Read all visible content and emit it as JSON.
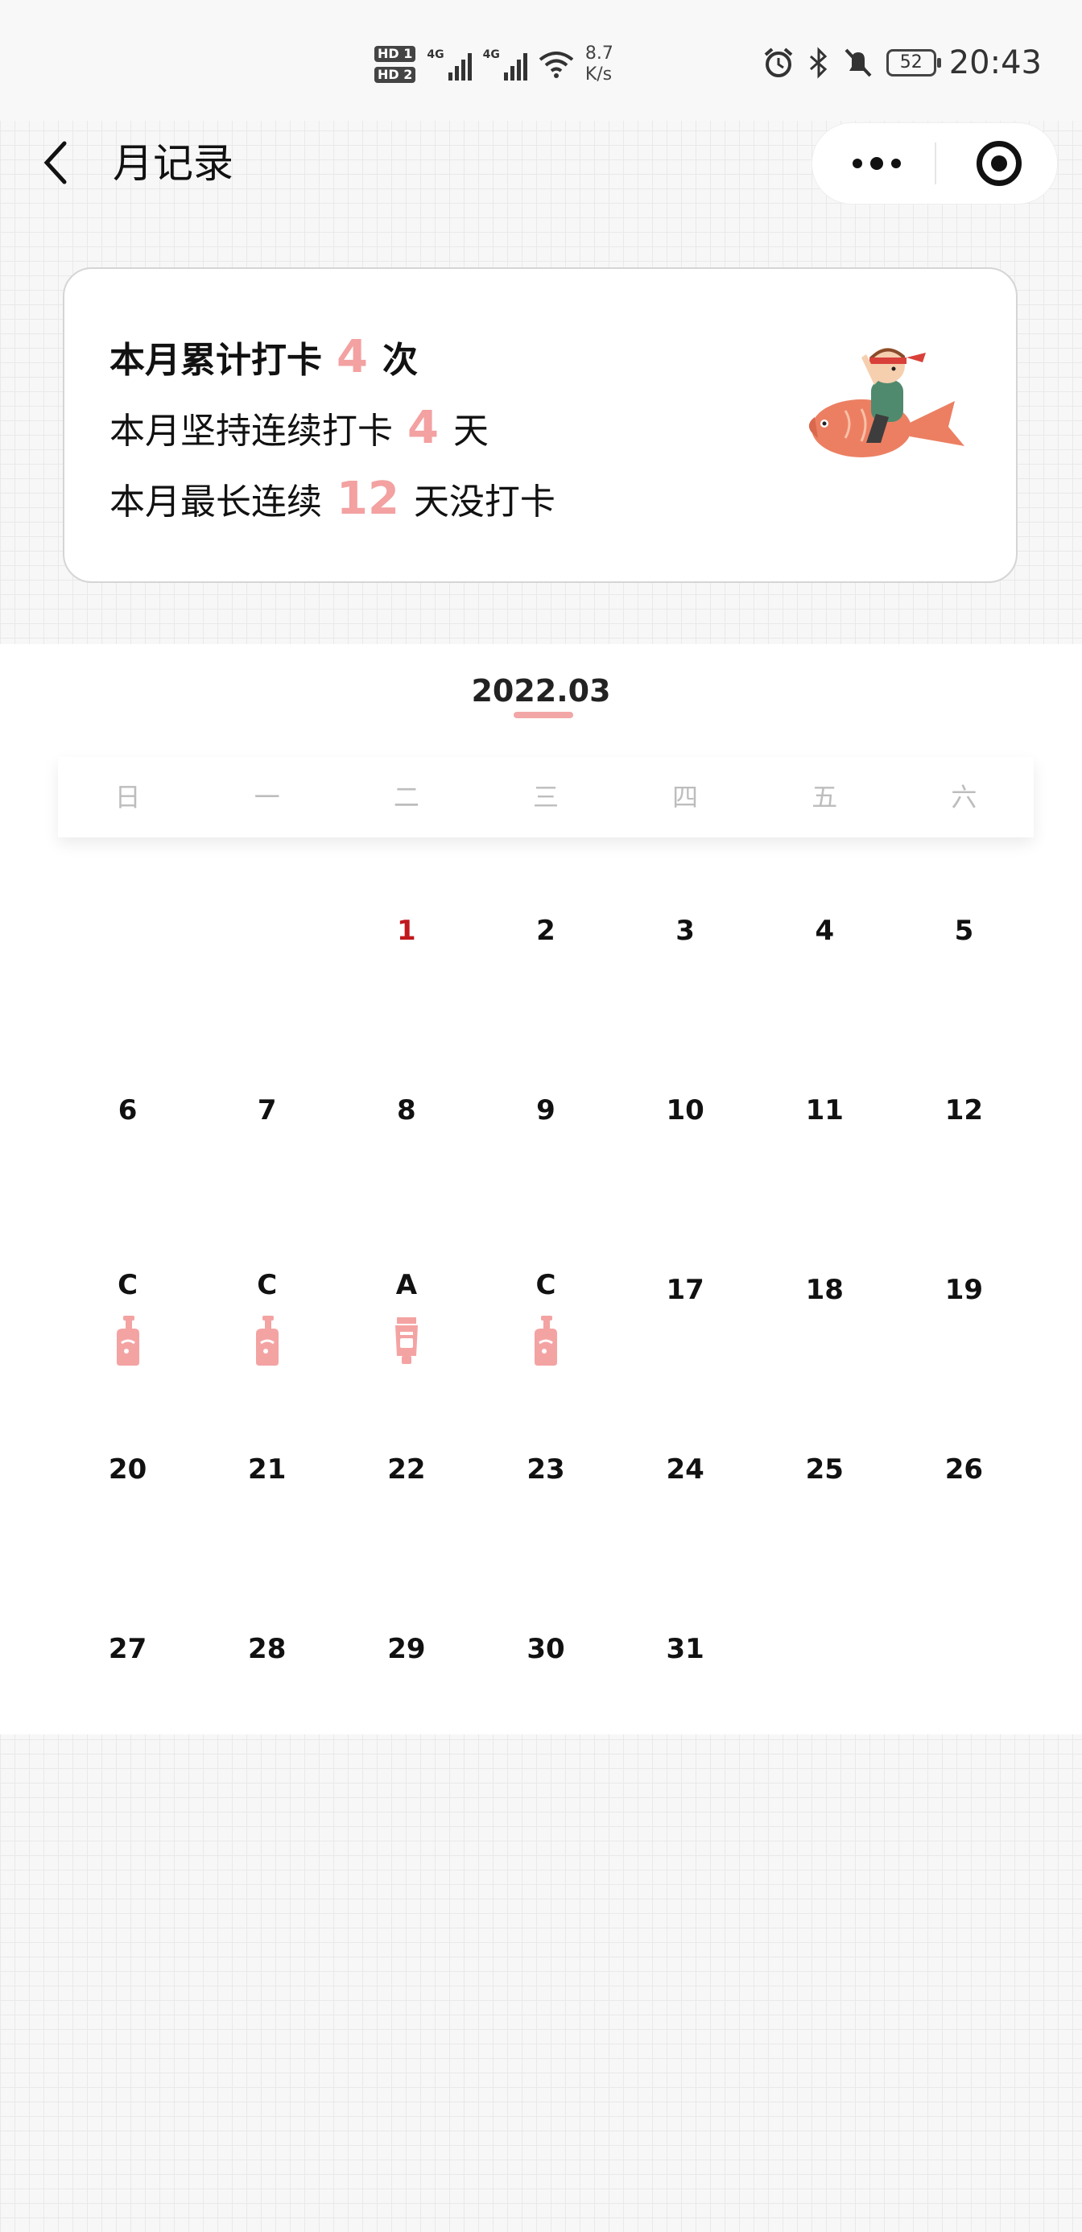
{
  "status_bar": {
    "hd1": "HD 1",
    "hd2": "HD 2",
    "net1": "4G",
    "net2": "4G",
    "speed_value": "8.7",
    "speed_unit": "K/s",
    "battery": "52",
    "time": "20:43"
  },
  "nav": {
    "title": "月记录"
  },
  "summary": {
    "line1_prefix": "本月累计打卡",
    "line1_value": "4",
    "line1_suffix": "次",
    "line2_prefix": "本月坚持连续打卡",
    "line2_value": "4",
    "line2_suffix": "天",
    "line3_prefix": "本月最长连续",
    "line3_value": "12",
    "line3_suffix": "天没打卡"
  },
  "calendar": {
    "month": "2022.03",
    "weekdays": [
      "日",
      "一",
      "二",
      "三",
      "四",
      "五",
      "六"
    ],
    "days": [
      {
        "label": ""
      },
      {
        "label": ""
      },
      {
        "label": "1",
        "today": true
      },
      {
        "label": "2"
      },
      {
        "label": "3"
      },
      {
        "label": "4"
      },
      {
        "label": "5"
      },
      {
        "label": "6"
      },
      {
        "label": "7"
      },
      {
        "label": "8"
      },
      {
        "label": "9"
      },
      {
        "label": "10"
      },
      {
        "label": "11"
      },
      {
        "label": "12"
      },
      {
        "label": "C",
        "icon": "pump-bottle-icon"
      },
      {
        "label": "C",
        "icon": "pump-bottle-icon"
      },
      {
        "label": "A",
        "icon": "tube-icon"
      },
      {
        "label": "C",
        "icon": "pump-bottle-icon"
      },
      {
        "label": "17"
      },
      {
        "label": "18"
      },
      {
        "label": "19"
      },
      {
        "label": "20"
      },
      {
        "label": "21"
      },
      {
        "label": "22"
      },
      {
        "label": "23"
      },
      {
        "label": "24"
      },
      {
        "label": "25"
      },
      {
        "label": "26"
      },
      {
        "label": "27"
      },
      {
        "label": "28"
      },
      {
        "label": "29"
      },
      {
        "label": "30"
      },
      {
        "label": "31"
      }
    ]
  },
  "colors": {
    "accent": "#f3a1a1",
    "today": "#c0181e",
    "icon": "#f4a3a3"
  }
}
